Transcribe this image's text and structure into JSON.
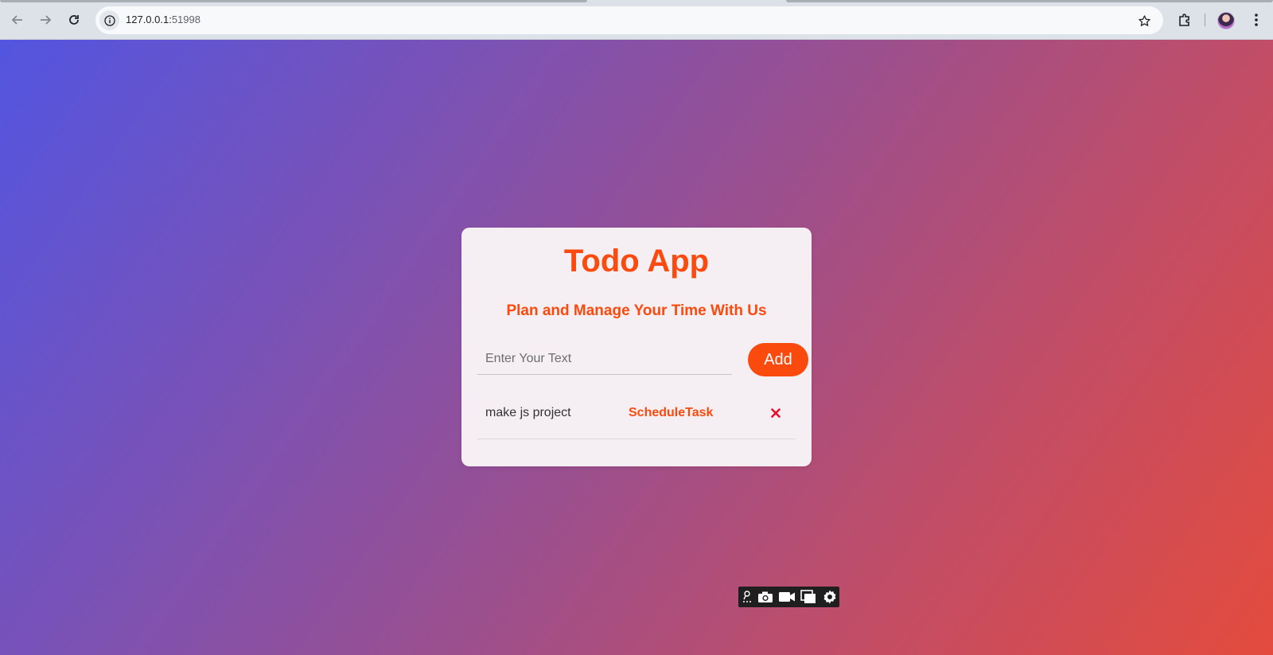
{
  "browser": {
    "url_host": "127.0.0.1:",
    "url_port": "51998",
    "icons": [
      "back-arrow-icon",
      "forward-arrow-icon",
      "reload-icon",
      "site-info-icon",
      "bookmark-star-icon",
      "extensions-icon",
      "profile-avatar",
      "more-menu-icon"
    ]
  },
  "app": {
    "title": "Todo App",
    "subtitle": "Plan and Manage Your Time With Us",
    "input": {
      "placeholder": "Enter Your Text",
      "value": ""
    },
    "add_label": "Add",
    "todos": [
      {
        "text": "make js project",
        "action_label": "ScheduleTask",
        "delete_icon": "close-x-icon"
      }
    ]
  },
  "capture_toolbar": {
    "icons": [
      "pin-icon",
      "camera-icon",
      "video-icon",
      "window-icon",
      "settings-gear-icon"
    ]
  },
  "colors": {
    "accent": "#fb4a0e",
    "card_bg": "#f5eef3",
    "gradient_start": "#5355e0",
    "gradient_end": "#e44b3d",
    "delete_red": "#e8112d"
  }
}
